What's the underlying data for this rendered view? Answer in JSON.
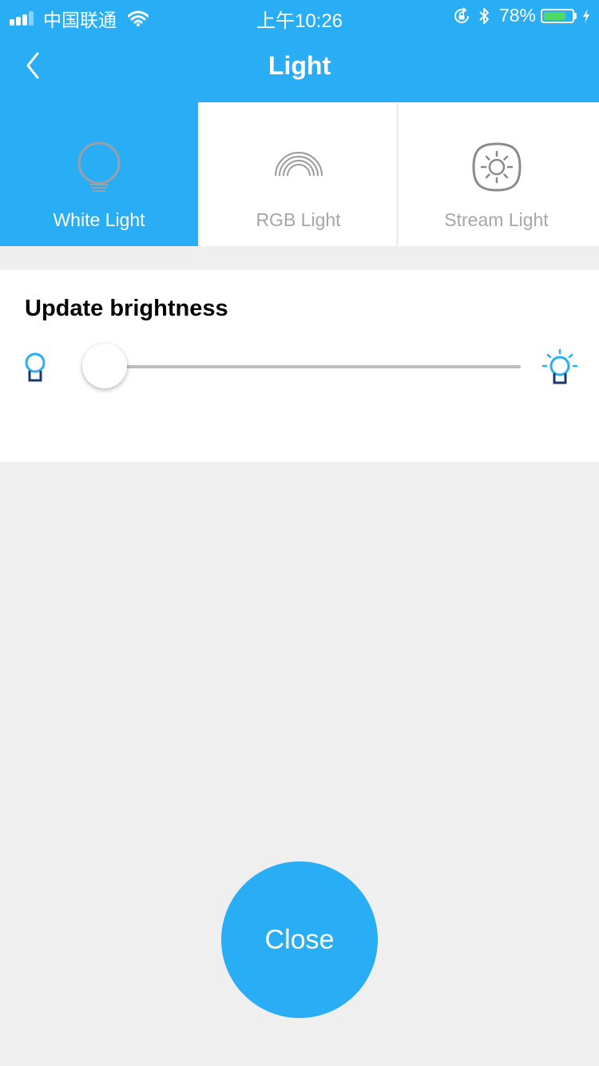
{
  "status_bar": {
    "carrier": "中国联通",
    "time": "上午10:26",
    "battery_percent": "78%",
    "battery_level": 0.78,
    "signal_bars": 3,
    "icons": [
      "signal-icon",
      "wifi-icon",
      "orientation-lock-icon",
      "bluetooth-icon",
      "battery-icon",
      "charging-icon"
    ]
  },
  "header": {
    "title": "Light",
    "back_icon": "chevron-left-icon"
  },
  "tabs": [
    {
      "label": "White Light",
      "icon": "bulb-icon",
      "active": true
    },
    {
      "label": "RGB Light",
      "icon": "rainbow-icon",
      "active": false
    },
    {
      "label": "Stream Light",
      "icon": "sun-icon",
      "active": false
    }
  ],
  "brightness": {
    "title": "Update brightness",
    "value": 0.05,
    "min_icon": "dim-bulb-icon",
    "max_icon": "bright-bulb-icon"
  },
  "close_button": {
    "label": "Close"
  },
  "colors": {
    "accent": "#29aef6",
    "background": "#efefef",
    "inactive_text": "#a6a6a6",
    "battery": "#4cd964"
  }
}
